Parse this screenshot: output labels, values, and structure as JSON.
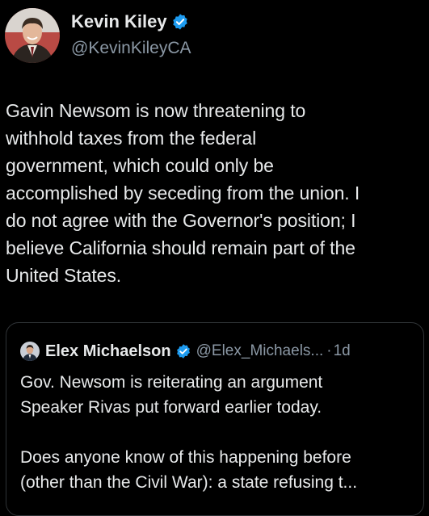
{
  "tweet": {
    "author": {
      "display_name": "Kevin Kiley",
      "handle": "@KevinKileyCA",
      "verified": true,
      "avatar_icon": "profile-photo"
    },
    "text": "Gavin Newsom is now threatening to\nwithhold taxes from the federal\ngovernment, which could only be\naccomplished by seceding from the union. I\ndo not agree with the Governor's position; I\nbelieve California should remain part of the\nUnited States."
  },
  "quoted_tweet": {
    "author": {
      "display_name": "Elex Michaelson",
      "handle": "@Elex_Michaels...",
      "verified": true,
      "avatar_icon": "profile-photo"
    },
    "separator": "·",
    "time": "1d",
    "text": "Gov. Newsom is reiterating an argument\nSpeaker Rivas put forward earlier today.\n\nDoes anyone know of this happening before\n(other than the Civil War): a state refusing t..."
  },
  "colors": {
    "background": "#000000",
    "primary_text": "#e7e9ea",
    "secondary_text": "#8b98a5",
    "verified_badge": "#1d9bf0",
    "card_border": "#2f3336"
  }
}
